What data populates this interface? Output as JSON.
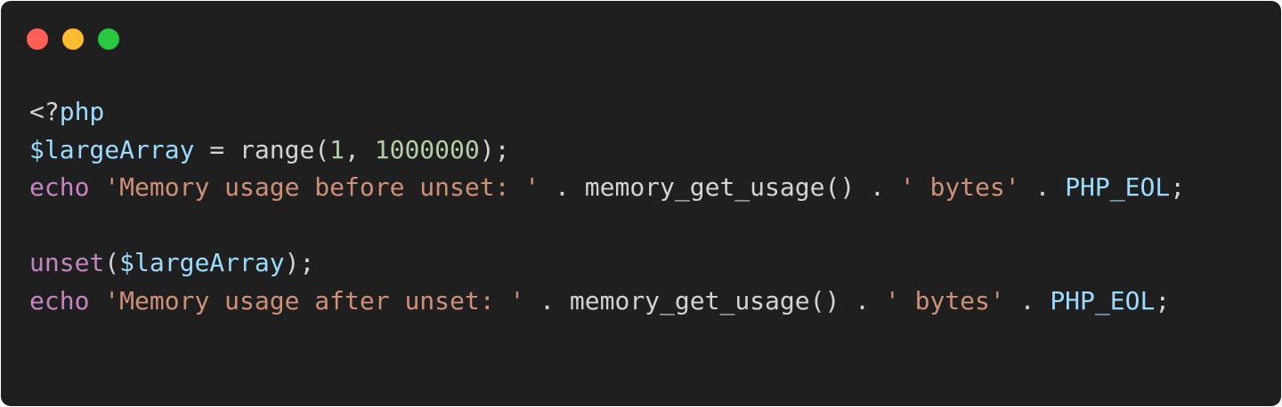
{
  "window": {
    "buttons": [
      {
        "name": "close-dot",
        "color": "#ff5f57"
      },
      {
        "name": "minimize-dot",
        "color": "#febc2e"
      },
      {
        "name": "maximize-dot",
        "color": "#28c840"
      }
    ]
  },
  "code": {
    "language": "php",
    "lines": [
      [
        {
          "text": "<?",
          "type": "plain"
        },
        {
          "text": "php",
          "type": "var"
        }
      ],
      [
        {
          "text": "$largeArray",
          "type": "var"
        },
        {
          "text": " = range(",
          "type": "plain"
        },
        {
          "text": "1",
          "type": "num"
        },
        {
          "text": ", ",
          "type": "plain"
        },
        {
          "text": "1000000",
          "type": "num"
        },
        {
          "text": ");",
          "type": "plain"
        }
      ],
      [
        {
          "text": "echo",
          "type": "kw"
        },
        {
          "text": " ",
          "type": "plain"
        },
        {
          "text": "'Memory usage before unset: '",
          "type": "str"
        },
        {
          "text": " . memory_get_usage() . ",
          "type": "plain"
        },
        {
          "text": "' bytes'",
          "type": "str"
        },
        {
          "text": " . ",
          "type": "plain"
        },
        {
          "text": "PHP_EOL",
          "type": "const"
        },
        {
          "text": ";",
          "type": "plain"
        }
      ],
      [],
      [
        {
          "text": "unset",
          "type": "kw"
        },
        {
          "text": "(",
          "type": "plain"
        },
        {
          "text": "$largeArray",
          "type": "var"
        },
        {
          "text": ");",
          "type": "plain"
        }
      ],
      [
        {
          "text": "echo",
          "type": "kw"
        },
        {
          "text": " ",
          "type": "plain"
        },
        {
          "text": "'Memory usage after unset: '",
          "type": "str"
        },
        {
          "text": " . memory_get_usage() . ",
          "type": "plain"
        },
        {
          "text": "' bytes'",
          "type": "str"
        },
        {
          "text": " . ",
          "type": "plain"
        },
        {
          "text": "PHP_EOL",
          "type": "const"
        },
        {
          "text": ";",
          "type": "plain"
        }
      ]
    ]
  }
}
